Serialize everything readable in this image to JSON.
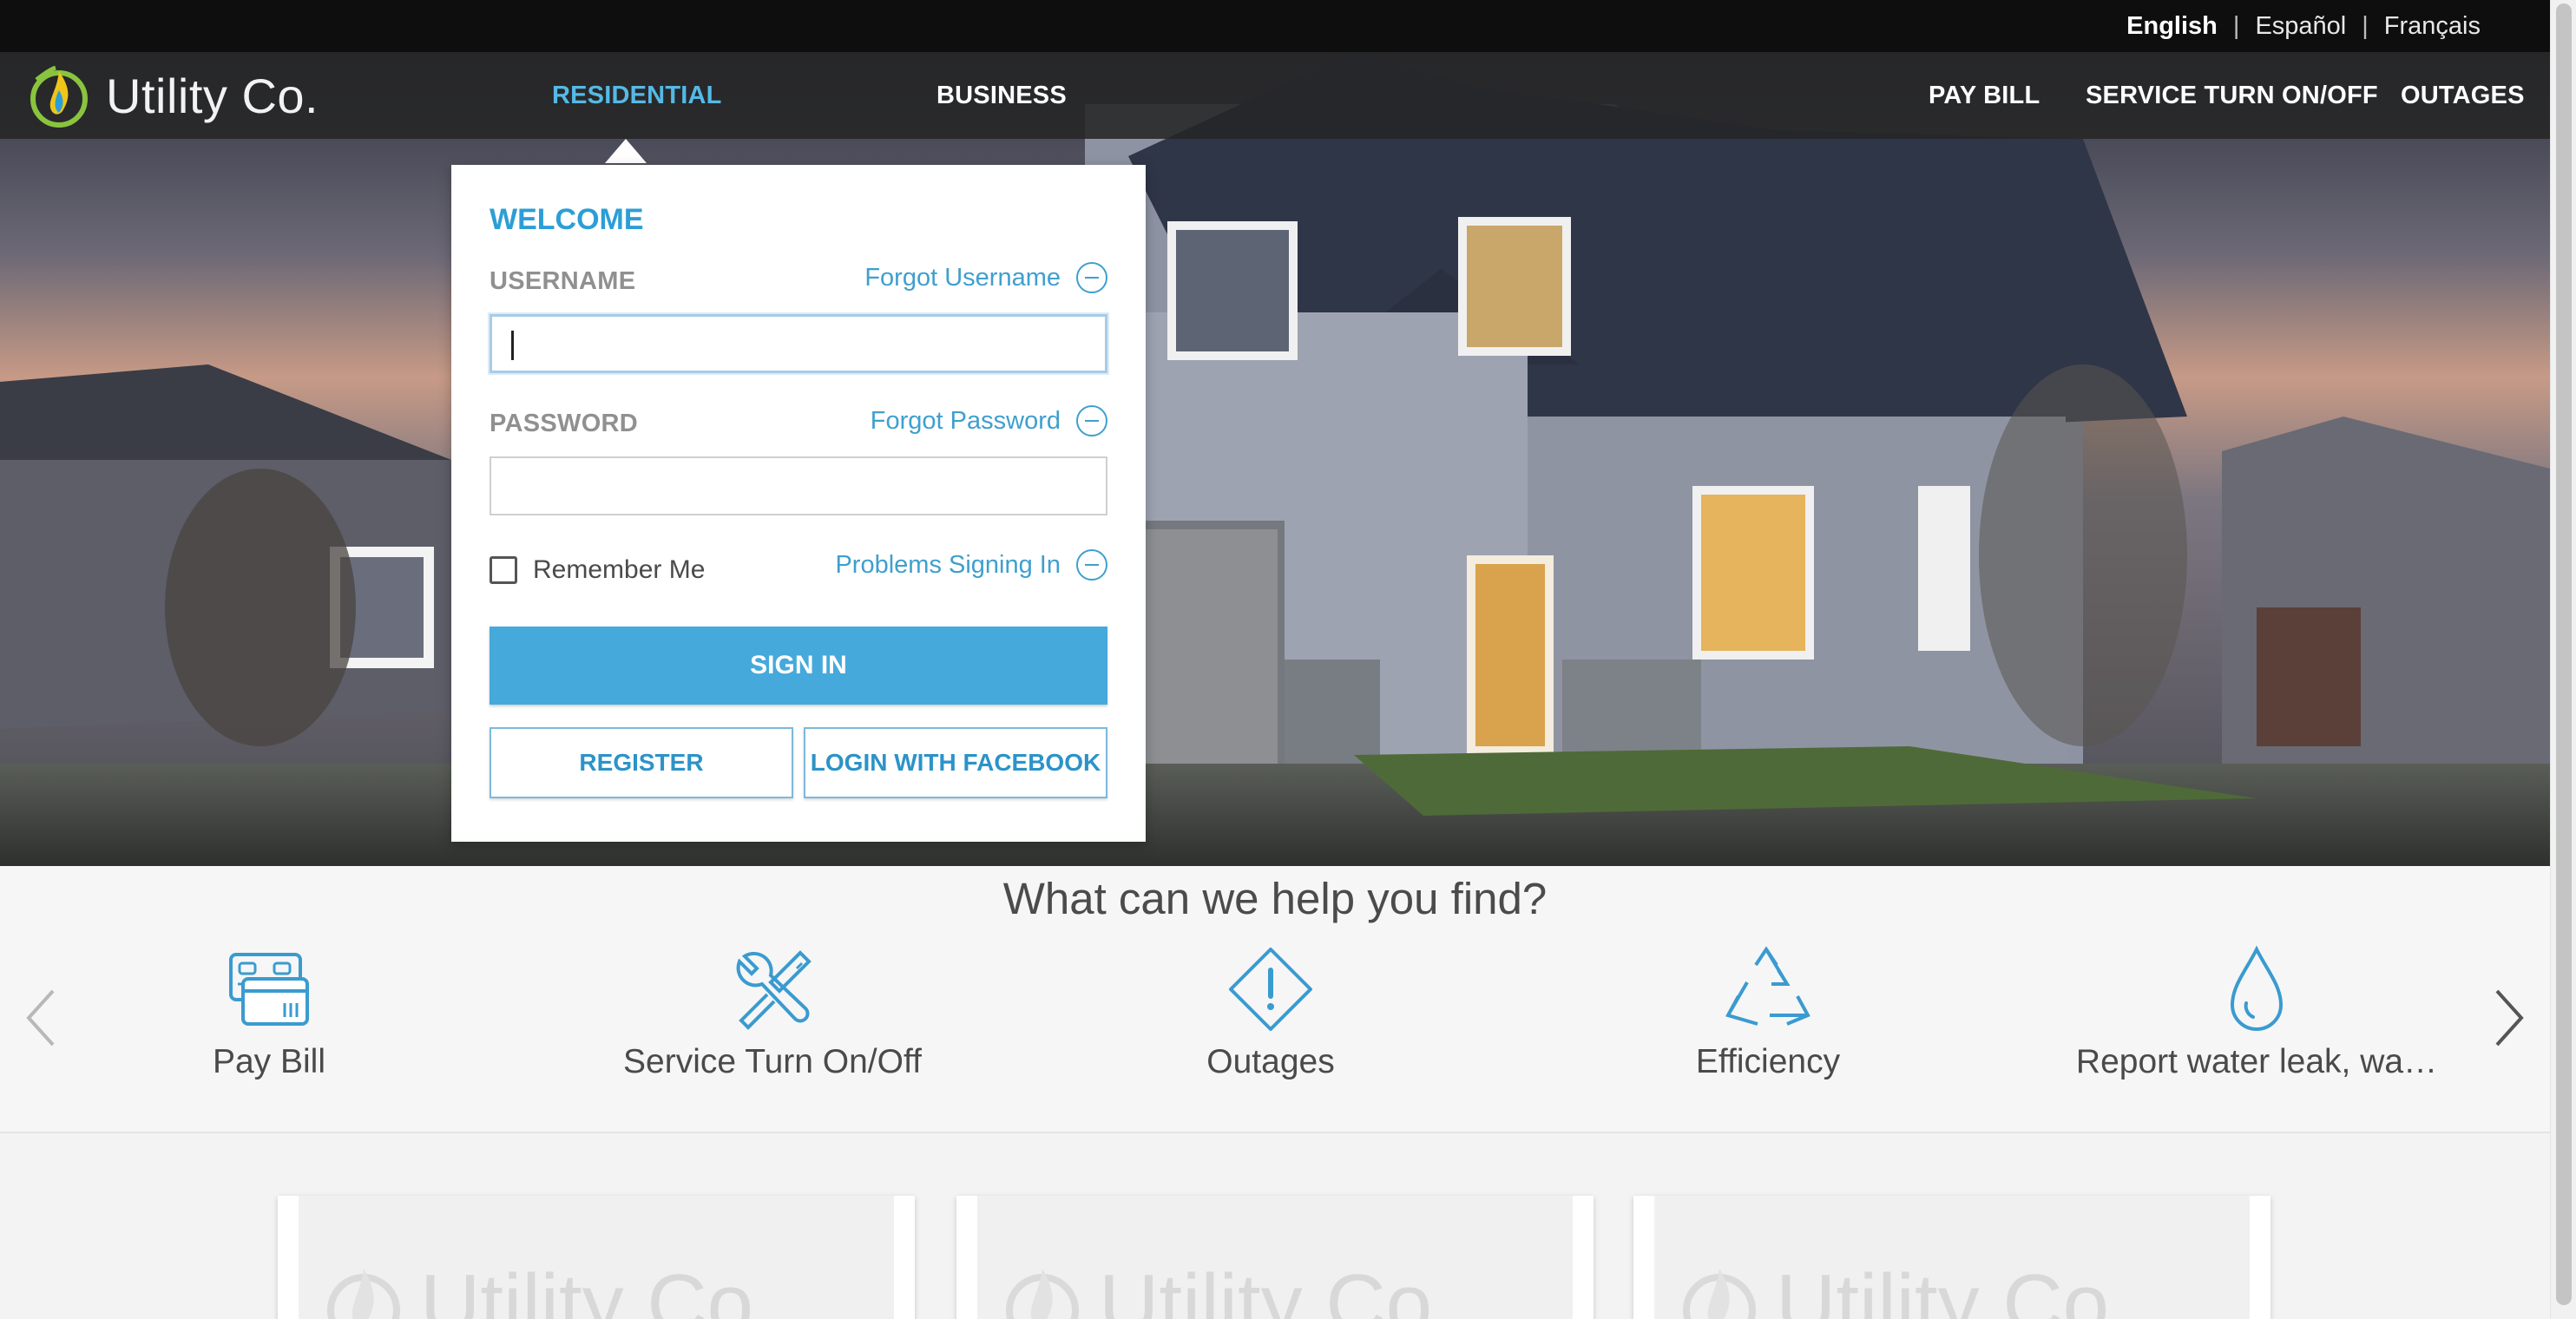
{
  "languages": {
    "english": "English",
    "spanish": "Español",
    "french": "Français",
    "separator": "|"
  },
  "nav": {
    "logo_text": "Utility Co.",
    "residential": "RESIDENTIAL",
    "business": "BUSINESS",
    "pay_bill": "PAY BILL",
    "service": "SERVICE TURN ON/OFF",
    "outages": "OUTAGES"
  },
  "login": {
    "welcome": "WELCOME",
    "username_label": "USERNAME",
    "forgot_username": "Forgot Username",
    "username_value": "",
    "password_label": "PASSWORD",
    "forgot_password": "Forgot Password",
    "password_value": "",
    "remember_me": "Remember Me",
    "remember_checked": false,
    "problems": "Problems Signing In",
    "sign_in": "SIGN IN",
    "register": "REGISTER",
    "facebook": "LOGIN WITH FACEBOOK"
  },
  "help": {
    "title": "What can we help you find?",
    "items": [
      {
        "label": "Pay Bill",
        "icon": "credit-card-icon"
      },
      {
        "label": "Service Turn On/Off",
        "icon": "tools-icon"
      },
      {
        "label": "Outages",
        "icon": "alert-diamond-icon"
      },
      {
        "label": "Efficiency",
        "icon": "recycle-icon"
      },
      {
        "label": "Report water leak, wa…",
        "icon": "water-drop-icon"
      }
    ]
  },
  "cards": {
    "watermark": "Utility Co."
  },
  "colors": {
    "accent": "#45a9dc",
    "link": "#3f9fcf",
    "nav_active": "#55b9e6",
    "topbar": "#0e0e0e"
  }
}
